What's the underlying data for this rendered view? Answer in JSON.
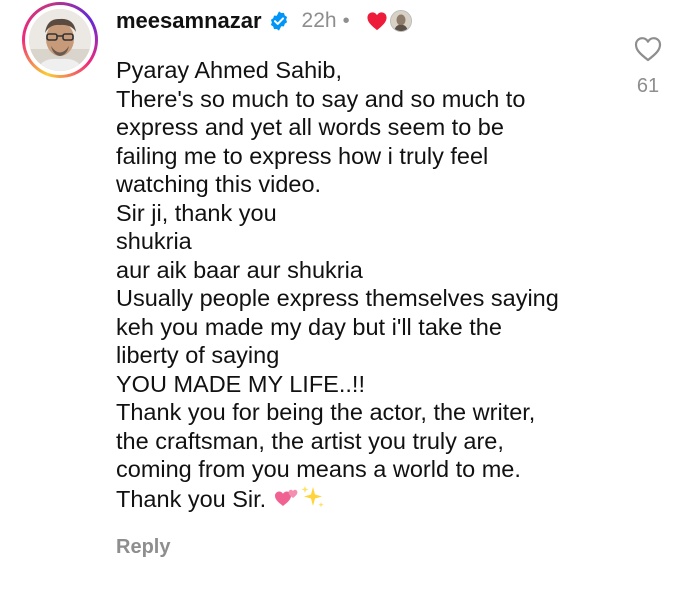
{
  "comment": {
    "username": "meesamnazar",
    "time": "22h",
    "separator": "•",
    "lines": [
      "Pyaray Ahmed Sahib,",
      "There's so much to say and so much to",
      "express and yet all words seem to be",
      "failing me to express how i truly feel",
      "watching this video.",
      "Sir ji, thank you",
      "shukria",
      "aur aik baar aur shukria",
      "Usually people express themselves saying",
      "keh you made my day but i'll take the",
      "liberty of saying",
      "YOU MADE MY LIFE..!!",
      "Thank you for being the actor, the writer,",
      "the craftsman, the artist you truly are,",
      "coming from you means  a world to me.",
      "Thank you Sir."
    ],
    "emojis": [
      "two-hearts-icon",
      "sparkles-icon"
    ],
    "reply_label": "Reply",
    "like_count": "61"
  },
  "colors": {
    "text": "#111111",
    "muted": "#8e8e8e",
    "verified": "#0095f6",
    "like_red": "#ed1c3a",
    "emoji_pink": "#f06292",
    "emoji_gold": "#ffd43b"
  }
}
